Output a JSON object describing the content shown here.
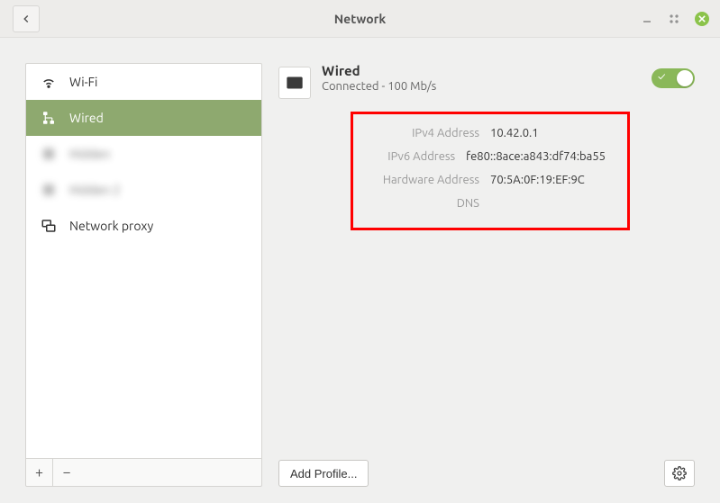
{
  "window": {
    "title": "Network"
  },
  "sidebar": {
    "items": [
      {
        "label": "Wi-Fi"
      },
      {
        "label": "Wired"
      },
      {
        "label": "Hidden"
      },
      {
        "label": "Hidden 2"
      },
      {
        "label": "Network proxy"
      }
    ]
  },
  "detail": {
    "title": "Wired",
    "status": "Connected - 100 Mb/s",
    "toggle_on": true,
    "fields": {
      "ipv4_label": "IPv4 Address",
      "ipv4_value": "10.42.0.1",
      "ipv6_label": "IPv6 Address",
      "ipv6_value": "fe80::8ace:a843:df74:ba55",
      "hw_label": "Hardware Address",
      "hw_value": "70:5A:0F:19:EF:9C",
      "dns_label": "DNS",
      "dns_value": ""
    }
  },
  "buttons": {
    "add_profile": "Add Profile..."
  }
}
